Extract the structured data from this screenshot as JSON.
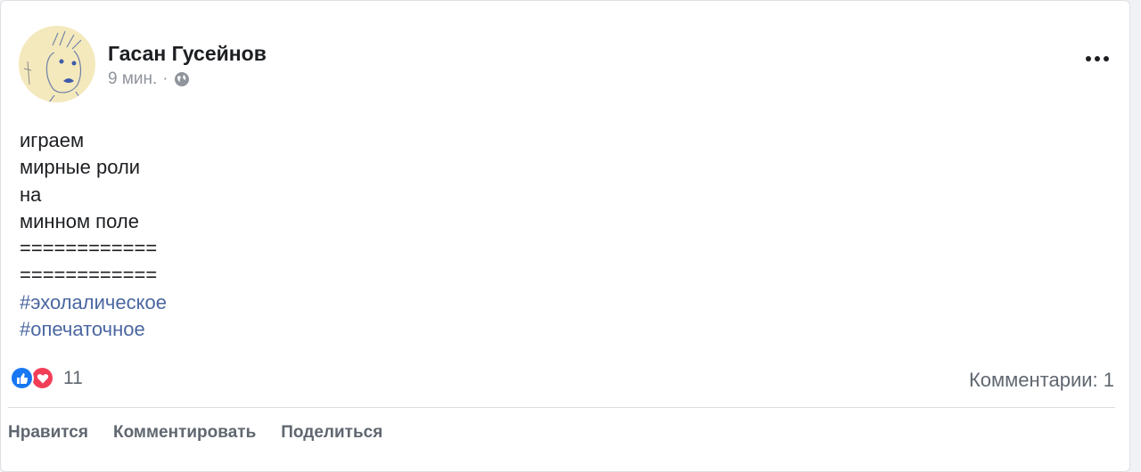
{
  "post": {
    "author": "Гасан Гусейнов",
    "time": "9 мин.",
    "separator": "·",
    "privacy_icon": "globe-icon",
    "more_icon": "more-options-icon",
    "lines": [
      "играем",
      "мирные роли",
      "на",
      "минном поле",
      "============",
      "============"
    ],
    "hashtags": [
      "#эхолалическое",
      "#опечаточное"
    ]
  },
  "reactions": {
    "icons": [
      "like-icon",
      "love-icon"
    ],
    "count": "11",
    "comments": "Комментарии: 1"
  },
  "actions": {
    "like": "Нравится",
    "comment": "Комментировать",
    "share": "Поделиться"
  },
  "colors": {
    "hashtag": "#4b67a1",
    "like": "#1877f2",
    "love": "#f33e58",
    "secondary_text": "#606770"
  }
}
